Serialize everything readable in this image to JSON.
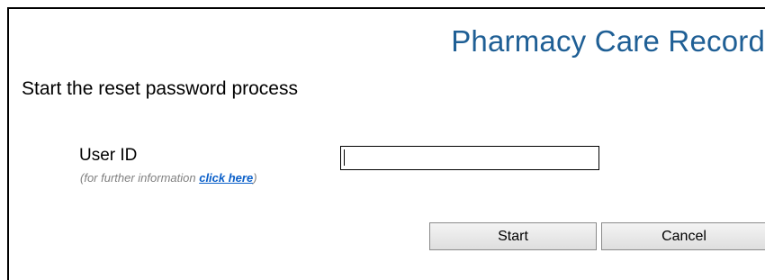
{
  "header": {
    "app_title": "Pharmacy Care Record"
  },
  "main": {
    "heading": "Start the reset password process",
    "user_id_label": "User ID",
    "help_prefix": "(for further information ",
    "help_link": "click here",
    "help_suffix": ")",
    "user_id_value": ""
  },
  "actions": {
    "start_label": "Start",
    "cancel_label": "Cancel"
  },
  "colors": {
    "title": "#1f5f95",
    "link": "#0a5fc9",
    "hint": "#808080"
  }
}
